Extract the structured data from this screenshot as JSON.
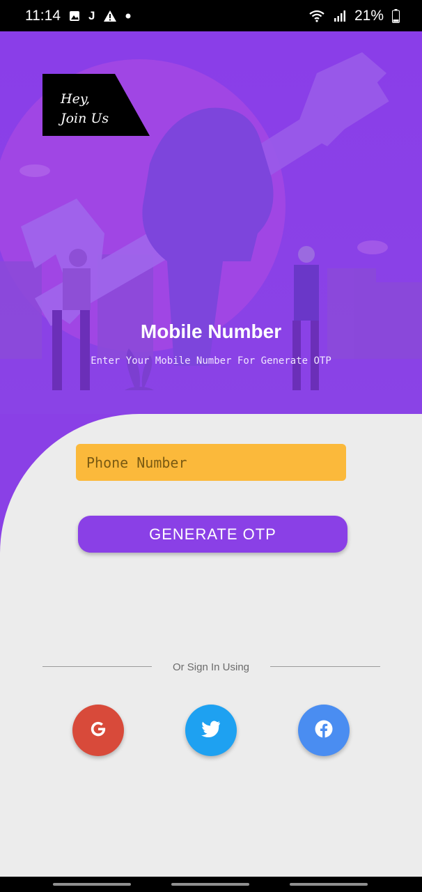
{
  "status_bar": {
    "time": "11:14",
    "notification_icons": [
      "gallery-icon",
      "j-app-icon",
      "warning-icon",
      "dot-icon"
    ],
    "j_glyph": "J",
    "battery": "21%",
    "system_icons": [
      "wifi-icon",
      "signal-icon",
      "battery-icon"
    ]
  },
  "badge": {
    "line1": "Hey,",
    "line2": "Join Us"
  },
  "hero": {
    "title": "Mobile Number",
    "subtitle": "Enter Your Mobile Number For Generate OTP"
  },
  "form": {
    "phone_placeholder": "Phone Number",
    "phone_value": "",
    "generate_label": "GENERATE OTP"
  },
  "divider": {
    "label": "Or Sign In Using"
  },
  "social": [
    {
      "name": "google",
      "glyph": "G",
      "color": "#d84a3a"
    },
    {
      "name": "twitter",
      "color": "#1ea1f1"
    },
    {
      "name": "facebook",
      "glyph": "f",
      "color": "#4a8df1"
    }
  ],
  "colors": {
    "primary": "#8a40e6",
    "input": "#fbb93b",
    "background": "#ececec"
  }
}
